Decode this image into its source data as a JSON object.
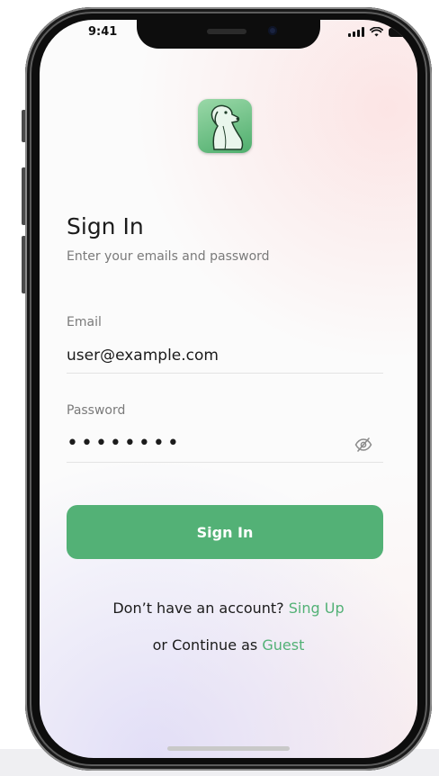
{
  "status_bar": {
    "time": "9:41"
  },
  "app": {
    "logo_icon": "dog-icon"
  },
  "signin": {
    "title": "Sign In",
    "subtitle": "Enter your emails and password",
    "email": {
      "label": "Email",
      "value": "user@example.com"
    },
    "password": {
      "label": "Password",
      "value": "••••••••",
      "visibility_icon": "eye-slash-icon"
    },
    "button_label": "Sign In",
    "signup_prompt": "Don’t have an account?",
    "signup_link": "Sing Up",
    "guest_prompt": "or Continue as",
    "guest_link": "Guest"
  },
  "colors": {
    "accent": "#53b176",
    "text_primary": "#1b1b1b",
    "text_secondary": "#7a7a7a"
  }
}
